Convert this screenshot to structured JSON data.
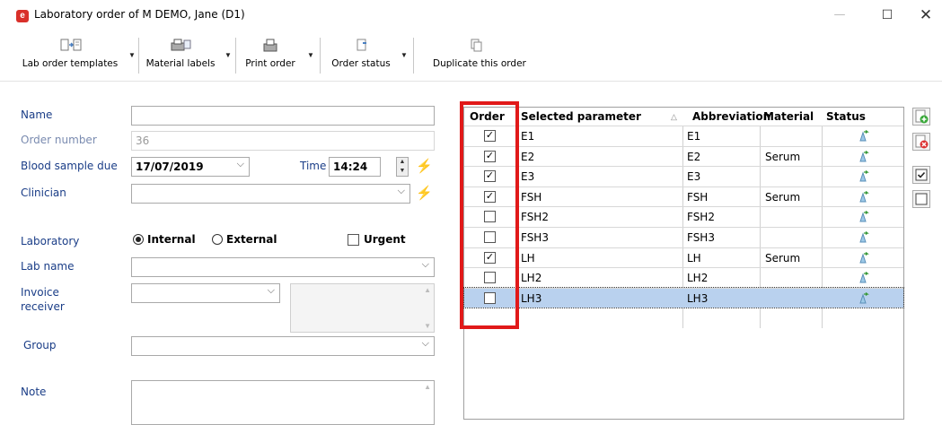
{
  "window": {
    "title": "Laboratory order of M DEMO, Jane (D1)",
    "minimize": "—",
    "maximize": "☐",
    "close": "✕"
  },
  "toolbar": {
    "lab_templates": "Lab order templates",
    "material_labels": "Material labels",
    "print_order": "Print order",
    "order_status": "Order status",
    "duplicate": "Duplicate this order"
  },
  "form": {
    "name_label": "Name",
    "name_value": "",
    "order_number_label": "Order number",
    "order_number_value": "36",
    "blood_due_label": "Blood sample due",
    "blood_due_value": "17/07/2019",
    "time_label": "Time",
    "time_value": "14:24",
    "clinician_label": "Clinician",
    "clinician_value": "",
    "laboratory_label": "Laboratory",
    "radio_internal": "Internal",
    "radio_external": "External",
    "urgent_label": "Urgent",
    "lab_name_label": "Lab name",
    "invoice_label_1": "Invoice",
    "invoice_label_2": "receiver",
    "group_label": "Group",
    "note_label": "Note"
  },
  "grid": {
    "columns": {
      "order": "Order",
      "parameter": "Selected parameter",
      "abbreviation": "Abbreviation",
      "material": "Material",
      "status": "Status"
    },
    "rows": [
      {
        "checked": true,
        "check_glyph": "✓",
        "parameter": "E1",
        "abbreviation": "E1",
        "material": ""
      },
      {
        "checked": true,
        "check_glyph": "✓",
        "parameter": "E2",
        "abbreviation": "E2",
        "material": "Serum"
      },
      {
        "checked": true,
        "check_glyph": "✓",
        "parameter": "E3",
        "abbreviation": "E3",
        "material": ""
      },
      {
        "checked": true,
        "check_glyph": "✓",
        "parameter": "FSH",
        "abbreviation": "FSH",
        "material": "Serum"
      },
      {
        "checked": false,
        "check_glyph": "",
        "parameter": "FSH2",
        "abbreviation": "FSH2",
        "material": ""
      },
      {
        "checked": false,
        "check_glyph": "",
        "parameter": "FSH3",
        "abbreviation": "FSH3",
        "material": ""
      },
      {
        "checked": true,
        "check_glyph": "✓",
        "parameter": "LH",
        "abbreviation": "LH",
        "material": "Serum"
      },
      {
        "checked": false,
        "check_glyph": "",
        "parameter": "LH2",
        "abbreviation": "LH2",
        "material": ""
      },
      {
        "checked": false,
        "check_glyph": "",
        "parameter": "LH3",
        "abbreviation": "LH3",
        "material": "",
        "selected": true
      }
    ]
  },
  "colors": {
    "label_blue": "#1a3d87",
    "highlight_red": "#e11919",
    "selected_row": "#b9d1ee"
  }
}
